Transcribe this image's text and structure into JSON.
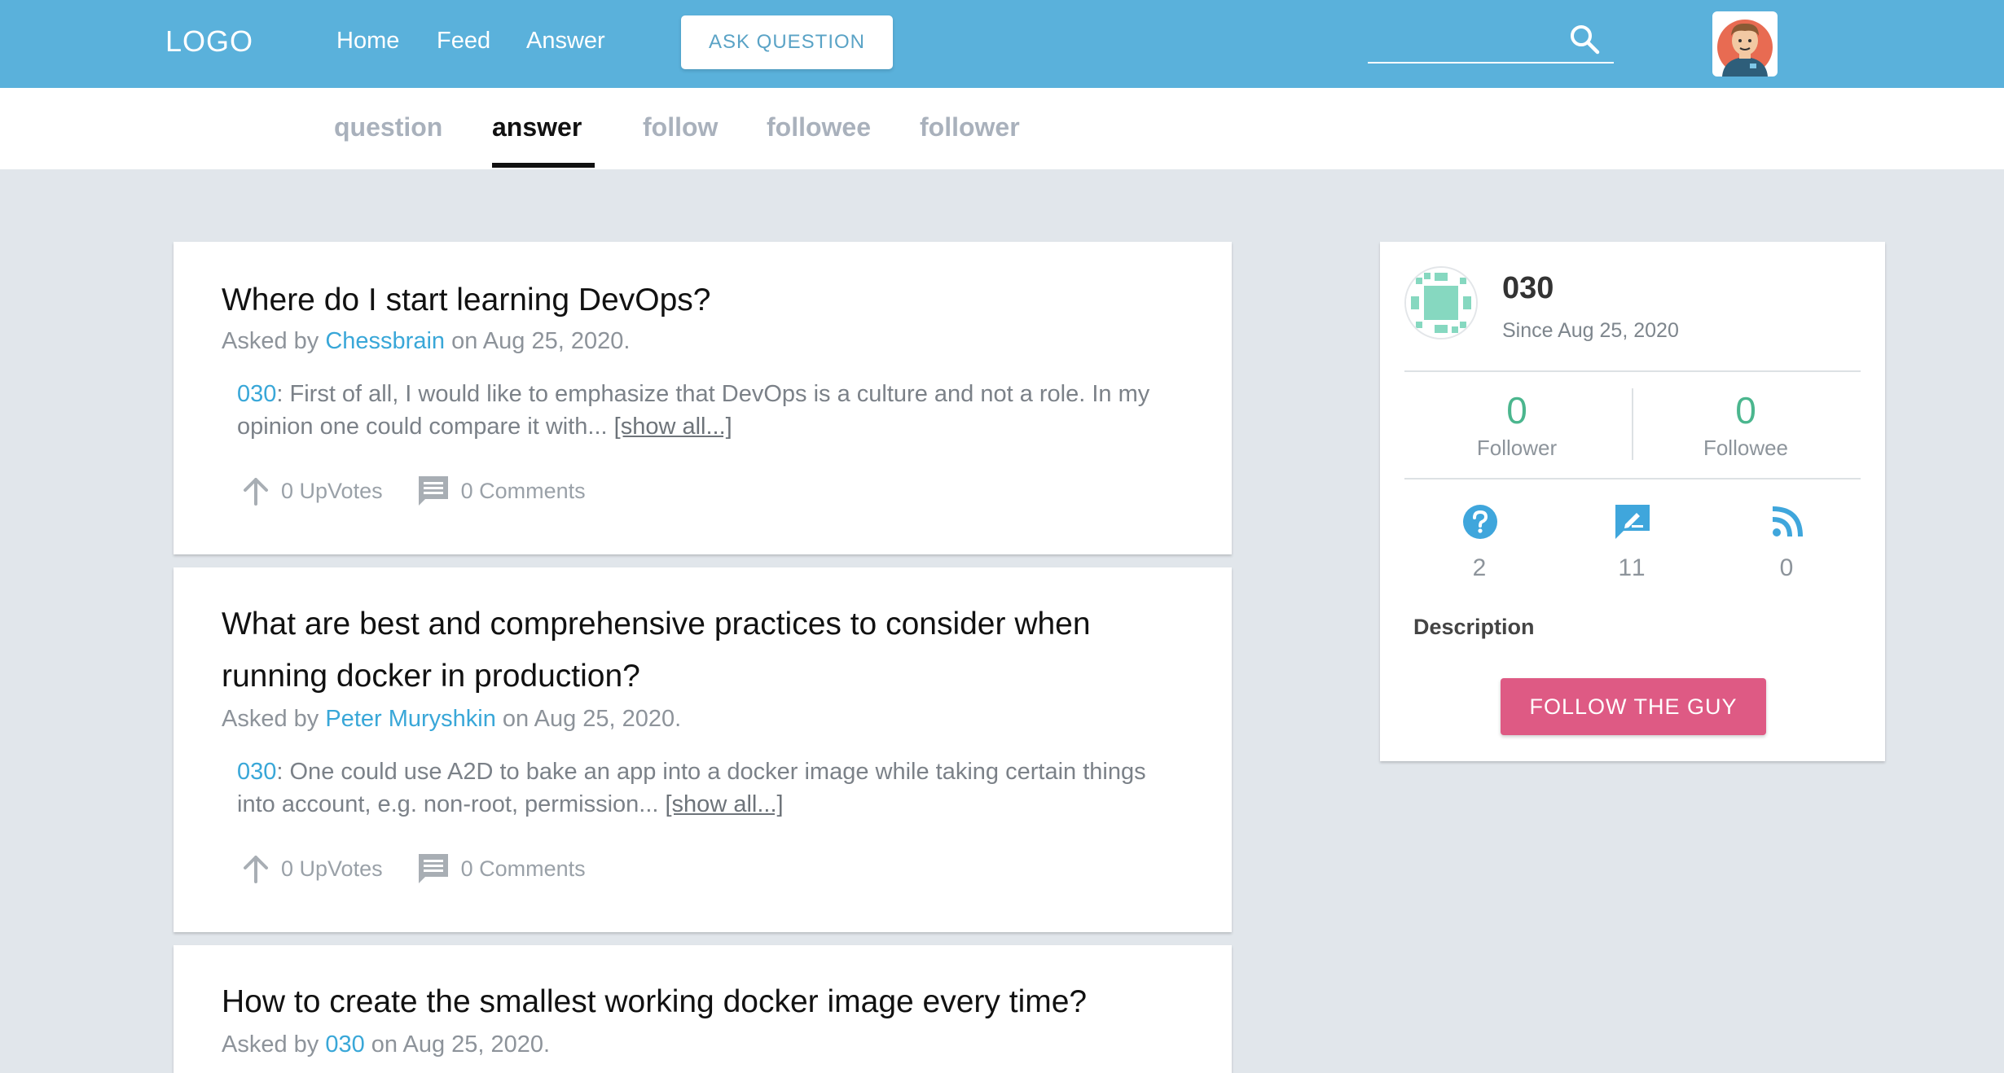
{
  "header": {
    "logo": "LOGO",
    "nav": [
      "Home",
      "Feed",
      "Answer"
    ],
    "ask_button": "ASK QUESTION",
    "search": {
      "value": "",
      "placeholder": ""
    },
    "brand_color": "#5ab1db"
  },
  "tabs": {
    "items": [
      "question",
      "answer",
      "follow",
      "followee",
      "follower"
    ],
    "active": "answer"
  },
  "answers": [
    {
      "title": "Where do I start learning DevOps?",
      "asked_prefix": "Asked by ",
      "asker": "Chessbrain",
      "asked_suffix": " on Aug 25, 2020.",
      "answerer": "030",
      "excerpt": ": First of all, I would like to emphasize that DevOps is a culture and not a role. In my opinion one could compare it with... ",
      "show_all": "[show all...]",
      "upvotes": "0 UpVotes",
      "comments": "0 Comments"
    },
    {
      "title": "What are best and comprehensive practices to consider when running docker in production?",
      "asked_prefix": "Asked by ",
      "asker": "Peter Muryshkin",
      "asked_suffix": " on Aug 25, 2020.",
      "answerer": "030",
      "excerpt": ": One could use A2D to bake an app into a docker image while taking certain things into account, e.g. non-root, permission... ",
      "show_all": "[show all...]",
      "upvotes": "0 UpVotes",
      "comments": "0 Comments"
    },
    {
      "title": "How to create the smallest working docker image every time?",
      "asked_prefix": "Asked by ",
      "asker": "030",
      "asked_suffix": " on Aug 25, 2020."
    }
  ],
  "profile": {
    "name": "030",
    "since": "Since Aug 25, 2020",
    "follower_count": "0",
    "follower_label": "Follower",
    "followee_count": "0",
    "followee_label": "Followee",
    "questions_count": "2",
    "answers_count": "11",
    "feeds_count": "0",
    "description_label": "Description",
    "follow_button": "FOLLOW THE GUY",
    "accent_color": "#de5a84",
    "count_color": "#4bb68e",
    "icon_color": "#3fa6dc"
  }
}
